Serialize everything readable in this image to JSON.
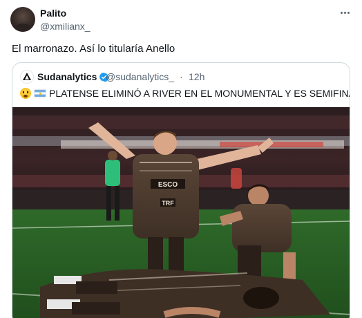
{
  "tweet": {
    "author": {
      "display_name": "Palito",
      "handle": "@xmilianx_"
    },
    "text": "El marronazo. Así lo titularía Anello",
    "more_icon": "more-horizontal-icon"
  },
  "quote": {
    "author": {
      "display_name": "Sudanalytics",
      "handle": "@sudanalytics_",
      "verified": true,
      "avatar_icon": "sudanalytics-logo-icon"
    },
    "separator": "·",
    "time": "12h",
    "text": "PLATENSE ELIMINÓ A RIVER EN EL MONUMENTAL Y ES SEMIFINALISTA.",
    "emojis": [
      "astonished-face-emoji",
      "argentina-flag-emoji"
    ],
    "photo": {
      "description": "football-celebration-photo",
      "shirt_texts": [
        "ESCO",
        "TRF"
      ]
    }
  },
  "colors": {
    "text_primary": "#0f1419",
    "text_secondary": "#536471",
    "border": "#cfd9de",
    "verified_blue": "#1d9bf0"
  }
}
